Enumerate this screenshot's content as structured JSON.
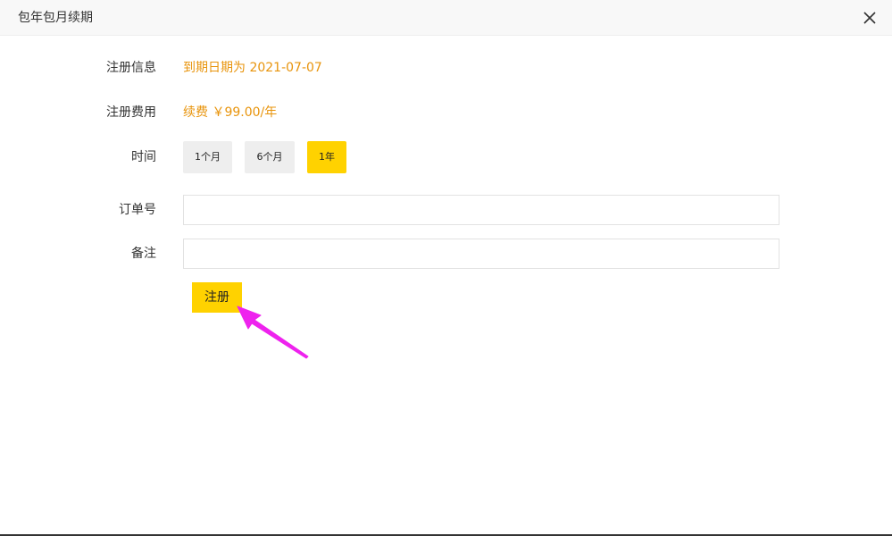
{
  "dialog": {
    "title": "包年包月续期"
  },
  "form": {
    "reg_info": {
      "label": "注册信息",
      "value": "到期日期为 2021-07-07"
    },
    "reg_fee": {
      "label": "注册费用",
      "value": "续费 ￥99.00/年"
    },
    "duration": {
      "label": "时间",
      "options": [
        "1个月",
        "6个月",
        "1年"
      ],
      "selected": "1年"
    },
    "order_no": {
      "label": "订单号",
      "value": "",
      "placeholder": ""
    },
    "remark": {
      "label": "备注",
      "value": "",
      "placeholder": ""
    },
    "submit_label": "注册"
  },
  "colors": {
    "accent": "#ffd200",
    "value_text": "#e8940c",
    "annotation_arrow": "#ee22ee"
  },
  "icons": {
    "close": "close-icon",
    "annotation": "pointer-arrow-icon"
  }
}
